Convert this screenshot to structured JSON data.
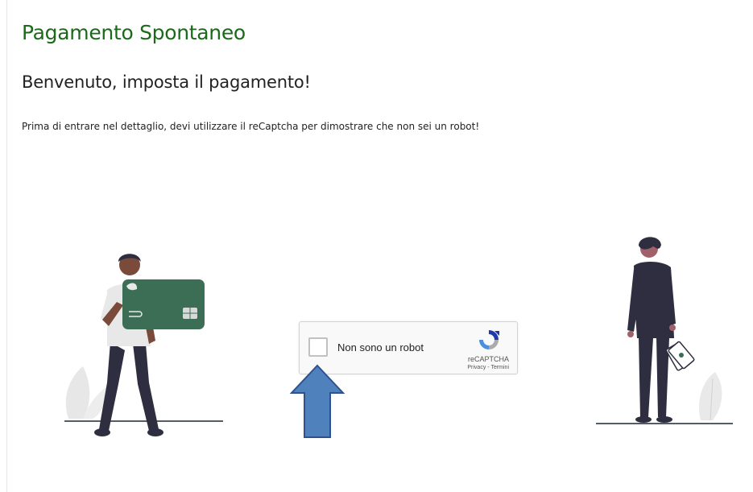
{
  "page": {
    "title": "Pagamento Spontaneo",
    "subtitle": "Benvenuto, imposta il pagamento!",
    "intro": "Prima di entrare nel dettaglio, devi utilizzare il reCaptcha per dimostrare che non sei un robot!"
  },
  "recaptcha": {
    "label": "Non sono un robot",
    "brand": "reCAPTCHA",
    "privacy": "Privacy",
    "separator": " - ",
    "terms": "Termini",
    "logo_icon": "recaptcha-logo-icon",
    "checked": false
  },
  "colors": {
    "title": "#1a6a1a",
    "card": "#3b6e55",
    "arrow_fill": "#4f81bd",
    "arrow_stroke": "#2f528f"
  },
  "icons": {
    "annotation": "up-arrow-icon"
  }
}
